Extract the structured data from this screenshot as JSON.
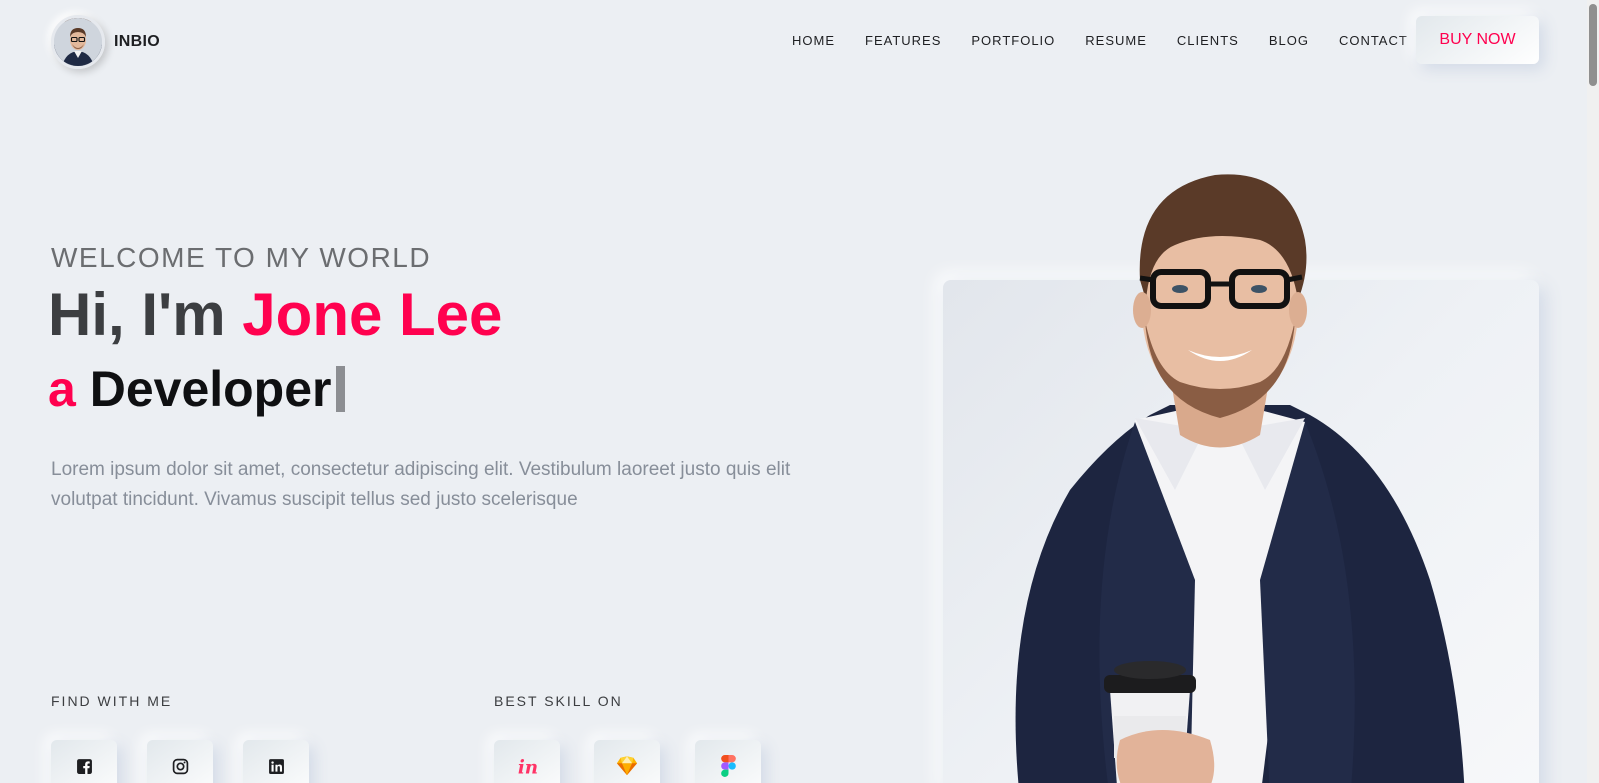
{
  "brand": {
    "name": "INBIO"
  },
  "nav": {
    "items": [
      "HOME",
      "FEATURES",
      "PORTFOLIO",
      "RESUME",
      "CLIENTS",
      "BLOG",
      "CONTACT"
    ],
    "cta": "BUY NOW"
  },
  "hero": {
    "subtitle": "WELCOME TO MY WORLD",
    "title_prefix": "Hi, I'm ",
    "title_name": "Jone Lee",
    "role_article": "a",
    "role_text": "Developer",
    "description": "Lorem ipsum dolor sit amet, consectetur adipiscing elit. Vestibulum laoreet justo quis elit volutpat tincidunt. Vivamus suscipit tellus sed justo scelerisque"
  },
  "social": {
    "label": "FIND WITH ME",
    "icons": [
      "facebook-icon",
      "instagram-icon",
      "linkedin-icon"
    ]
  },
  "skills": {
    "label": "BEST SKILL ON",
    "icons": [
      "invision-icon",
      "sketch-icon",
      "figma-icon"
    ]
  },
  "colors": {
    "accent": "#ff014f",
    "background": "#eceff3",
    "text": "#3c3e41"
  }
}
